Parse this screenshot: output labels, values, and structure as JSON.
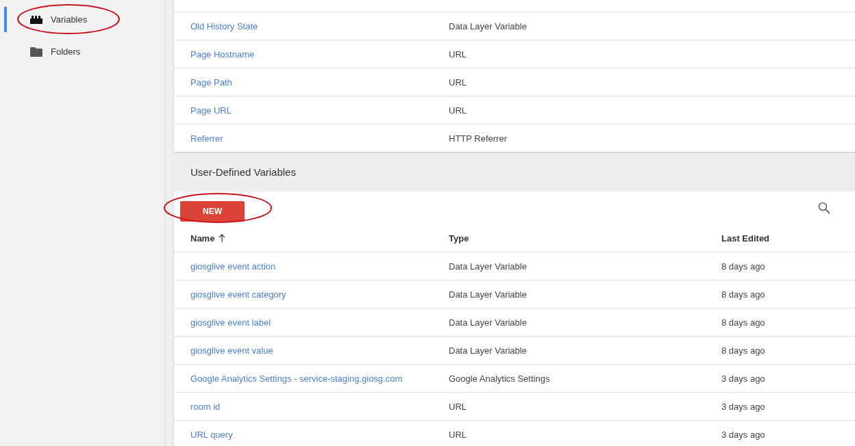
{
  "sidebar": {
    "items": [
      {
        "label": "Variables",
        "kind": "blocks",
        "selected": true,
        "circled": true
      },
      {
        "label": "Folders",
        "kind": "folder",
        "selected": false,
        "circled": false
      }
    ]
  },
  "built_in_table": {
    "rows": [
      {
        "name": "Old History State",
        "type": "Data Layer Variable"
      },
      {
        "name": "Page Hostname",
        "type": "URL"
      },
      {
        "name": "Page Path",
        "type": "URL"
      },
      {
        "name": "Page URL",
        "type": "URL"
      },
      {
        "name": "Referrer",
        "type": "HTTP Referrer"
      }
    ]
  },
  "section_title": "User-Defined Variables",
  "user_defined_table": {
    "new_button": {
      "label": "NEW",
      "circled": true
    },
    "columns": [
      {
        "label": "Name",
        "sorted": true
      },
      {
        "label": "Type"
      },
      {
        "label": "Last Edited"
      }
    ],
    "rows": [
      {
        "name": "giosglive event action",
        "type": "Data Layer Variable",
        "last_edited": "8 days ago"
      },
      {
        "name": "giosglive event category",
        "type": "Data Layer Variable",
        "last_edited": "8 days ago"
      },
      {
        "name": "giosglive event label",
        "type": "Data Layer Variable",
        "last_edited": "8 days ago"
      },
      {
        "name": "giosglive event value",
        "type": "Data Layer Variable",
        "last_edited": "8 days ago"
      },
      {
        "name": "Google Analytics Settings - service-staging.giosg.com",
        "type": "Google Analytics Settings",
        "last_edited": "3 days ago"
      },
      {
        "name": "room id",
        "type": "URL",
        "last_edited": "3 days ago"
      },
      {
        "name": "URL query",
        "type": "URL",
        "last_edited": "3 days ago"
      }
    ]
  }
}
